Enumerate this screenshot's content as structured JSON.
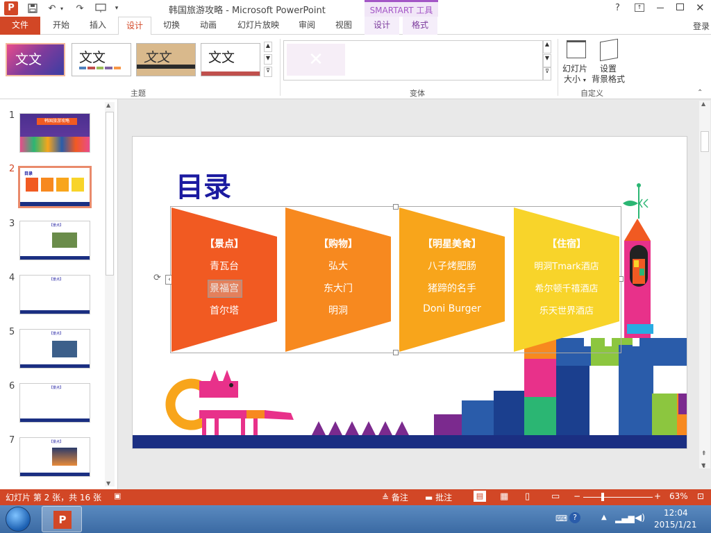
{
  "window": {
    "title": "韩国旅游攻略 - Microsoft PowerPoint",
    "context_tab_group": "SMARTART 工具",
    "help": "?",
    "login": "登录"
  },
  "tabs": {
    "file": "文件",
    "home": "开始",
    "insert": "插入",
    "design": "设计",
    "transitions": "切换",
    "animations": "动画",
    "slideshow": "幻灯片放映",
    "review": "审阅",
    "view": "视图",
    "smartart_design": "设计",
    "format": "格式"
  },
  "ribbon": {
    "theme_text": "文文",
    "themes_label": "主题",
    "variants_label": "变体",
    "slide_size_label1": "幻灯片",
    "slide_size_label2": "大小",
    "bg_format_label1": "设置",
    "bg_format_label2": "背景格式",
    "customize_label": "自定义"
  },
  "thumbnails": {
    "nums": [
      "1",
      "2",
      "3",
      "4",
      "5",
      "6",
      "7"
    ],
    "labels": {
      "t1": "韩国旅游攻略",
      "t2": "目录",
      "t3": "【景点】",
      "t4": "【景点】",
      "t5": "【景点】",
      "t6": "【景点】",
      "t7": "【景点】"
    }
  },
  "slide": {
    "title": "目录",
    "columns": [
      {
        "header": "【景点】",
        "items": [
          "青瓦台",
          "景福宫",
          "首尔塔"
        ],
        "color": "#f15a22"
      },
      {
        "header": "【购物】",
        "items": [
          "弘大",
          "东大门",
          "明洞"
        ],
        "color": "#f7891f"
      },
      {
        "header": "【明星美食】",
        "items": [
          "八子烤肥肠",
          "猪蹄的名手",
          "Doni Burger"
        ],
        "color": "#f8a51b"
      },
      {
        "header": "【住宿】",
        "items": [
          "明洞Tmark酒店",
          "希尔顿千禧酒店",
          "乐天世界酒店"
        ],
        "color": "#f8d42a"
      }
    ]
  },
  "status": {
    "slide_info": "幻灯片 第 2 张，共 16 张",
    "notes": "备注",
    "comments": "批注",
    "zoom": "63%"
  },
  "taskbar": {
    "time": "12:04",
    "date": "2015/1/21"
  },
  "colors": {
    "accent": "#d24726",
    "smartart_tab": "#a356c6"
  }
}
